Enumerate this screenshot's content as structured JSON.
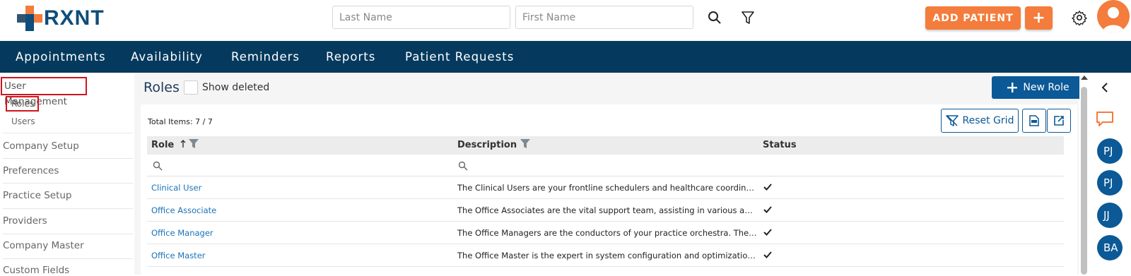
{
  "brand": {
    "name": "RXNT",
    "color_primary": "#0f4d7a",
    "color_accent": "#f47c3c"
  },
  "header": {
    "last_name_placeholder": "Last Name",
    "first_name_placeholder": "First Name",
    "search_icon": "search-icon",
    "filter_icon": "filter-icon",
    "add_patient_label": "ADD PATIENT",
    "add_plus_label": "+",
    "settings_icon": "gear-icon"
  },
  "nav": {
    "items": [
      "Appointments",
      "Availability",
      "Reminders",
      "Reports",
      "Patient Requests"
    ]
  },
  "sidebar": {
    "section": "User Management",
    "roles": "Roles",
    "users": "Users",
    "items": [
      "Company Setup",
      "Preferences",
      "Practice Setup",
      "Providers",
      "Company Master",
      "Custom Fields"
    ]
  },
  "main": {
    "title": "Roles",
    "show_deleted": "Show deleted",
    "new_role_label": "New Role",
    "total_items": "Total Items: 7 / 7",
    "reset_grid": "Reset Grid",
    "columns": {
      "role": "Role",
      "description": "Description",
      "status": "Status"
    },
    "rows": [
      {
        "role": "Clinical User",
        "description": "The Clinical Users are your frontline schedulers and healthcare coordinators. T..."
      },
      {
        "role": "Office Associate",
        "description": "The Office Associates are the vital support team, assisting in various administ..."
      },
      {
        "role": "Office Manager",
        "description": "The Office Managers are the conductors of your practice orchestra. They overs..."
      },
      {
        "role": "Office Master",
        "description": "The Office Master is the expert in system configuration and optimization. They..."
      }
    ]
  },
  "rail": {
    "avatars": [
      "PJ",
      "PJ",
      "JJ",
      "BA"
    ]
  }
}
